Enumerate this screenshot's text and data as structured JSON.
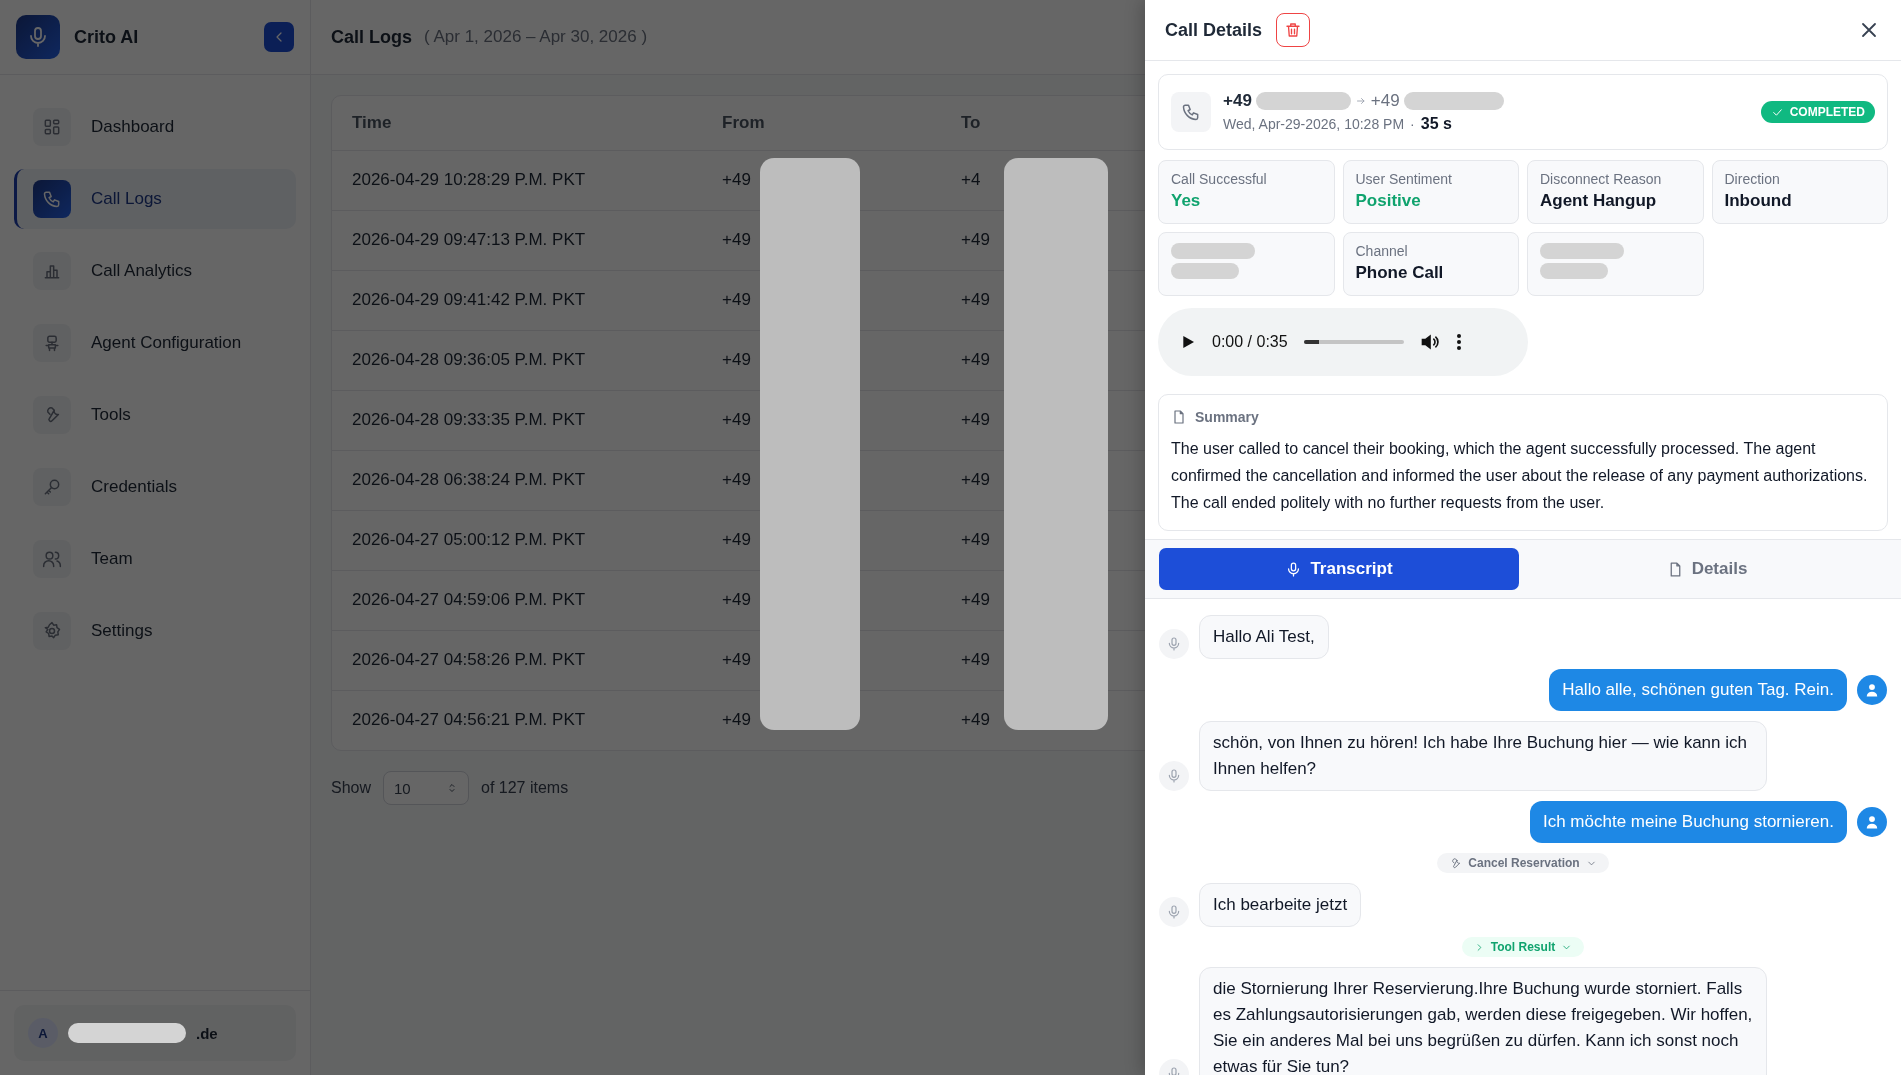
{
  "sidebar": {
    "brand": "Crito AI",
    "items": [
      {
        "label": "Dashboard",
        "selected": false
      },
      {
        "label": "Call Logs",
        "selected": true
      },
      {
        "label": "Call Analytics",
        "selected": false
      },
      {
        "label": "Agent Configuration",
        "selected": false
      },
      {
        "label": "Tools",
        "selected": false
      },
      {
        "label": "Credentials",
        "selected": false
      },
      {
        "label": "Team",
        "selected": false
      },
      {
        "label": "Settings",
        "selected": false
      }
    ],
    "user": {
      "initial": "A",
      "email_visible": ".de"
    }
  },
  "page": {
    "title": "Call Logs",
    "range": "( Apr 1, 2026 – Apr 30, 2026 )"
  },
  "table": {
    "columns": [
      "Time",
      "From",
      "To"
    ],
    "rows": [
      [
        "2026-04-29 10:28:29 P.M. PKT",
        "+49",
        "+4"
      ],
      [
        "2026-04-29 09:47:13 P.M. PKT",
        "+49",
        "+49"
      ],
      [
        "2026-04-29 09:41:42 P.M. PKT",
        "+49",
        "+49"
      ],
      [
        "2026-04-28 09:36:05 P.M. PKT",
        "+49",
        "+49"
      ],
      [
        "2026-04-28 09:33:35 P.M. PKT",
        "+49",
        "+49"
      ],
      [
        "2026-04-28 06:38:24 P.M. PKT",
        "+49",
        "+49"
      ],
      [
        "2026-04-27 05:00:12 P.M. PKT",
        "+49",
        "+49"
      ],
      [
        "2026-04-27 04:59:06 P.M. PKT",
        "+49",
        "+49"
      ],
      [
        "2026-04-27 04:58:26 P.M. PKT",
        "+49",
        "+49"
      ],
      [
        "2026-04-27 04:56:21 P.M. PKT",
        "+49",
        "+49"
      ]
    ]
  },
  "pagination": {
    "show_label": "Show",
    "page_size": "10",
    "total": "of 127 items"
  },
  "details": {
    "title": "Call Details",
    "from": "+49",
    "to": "+49",
    "datetime": "Wed, Apr-29-2026, 10:28 PM",
    "separator": "·",
    "duration": "35 s",
    "status": "COMPLETED",
    "stats": [
      {
        "kind": "field",
        "label": "Call Successful",
        "value": "Yes",
        "color": "#10a36e"
      },
      {
        "kind": "field",
        "label": "User Sentiment",
        "value": "Positive",
        "color": "#10a36e"
      },
      {
        "kind": "field",
        "label": "Disconnect Reason",
        "value": "Agent Hangup",
        "color": "#111827"
      },
      {
        "kind": "field",
        "label": "Direction",
        "value": "Inbound",
        "color": "#111827"
      },
      {
        "kind": "redacted"
      },
      {
        "kind": "field",
        "label": "Channel",
        "value": "Phone Call",
        "color": "#111827"
      },
      {
        "kind": "redacted"
      }
    ],
    "audio": {
      "time": "0:00 / 0:35",
      "level": 0.15
    },
    "summary": {
      "title": "Summary",
      "text": "The user called to cancel their booking, which the agent successfully processed. The agent confirmed the cancellation and informed the user about the release of any payment authorizations. The call ended politely with no further requests from the user."
    },
    "tabs": [
      {
        "label": "Transcript",
        "selected": true
      },
      {
        "label": "Details",
        "selected": false
      }
    ],
    "transcript": [
      {
        "kind": "agent",
        "text": "Hallo Ali Test,"
      },
      {
        "kind": "user",
        "text": "Hallo alle, schönen guten Tag. Rein."
      },
      {
        "kind": "agent",
        "text": "schön, von Ihnen zu hören! Ich habe Ihre Buchung hier — wie kann ich Ihnen helfen?"
      },
      {
        "kind": "user",
        "text": "Ich möchte meine Buchung stornieren."
      },
      {
        "kind": "tool_call",
        "text": "Cancel Reservation"
      },
      {
        "kind": "agent",
        "text": "Ich bearbeite jetzt"
      },
      {
        "kind": "tool_result",
        "text": "Tool Result"
      },
      {
        "kind": "agent",
        "text": "die Stornierung Ihrer Reservierung.Ihre Buchung wurde storniert. Falls es Zahlungsautorisierungen gab, werden diese freigegeben. Wir hoffen, Sie ein anderes Mal bei uns begrüßen zu dürfen. Kann ich sonst noch etwas für Sie tun?"
      }
    ]
  }
}
